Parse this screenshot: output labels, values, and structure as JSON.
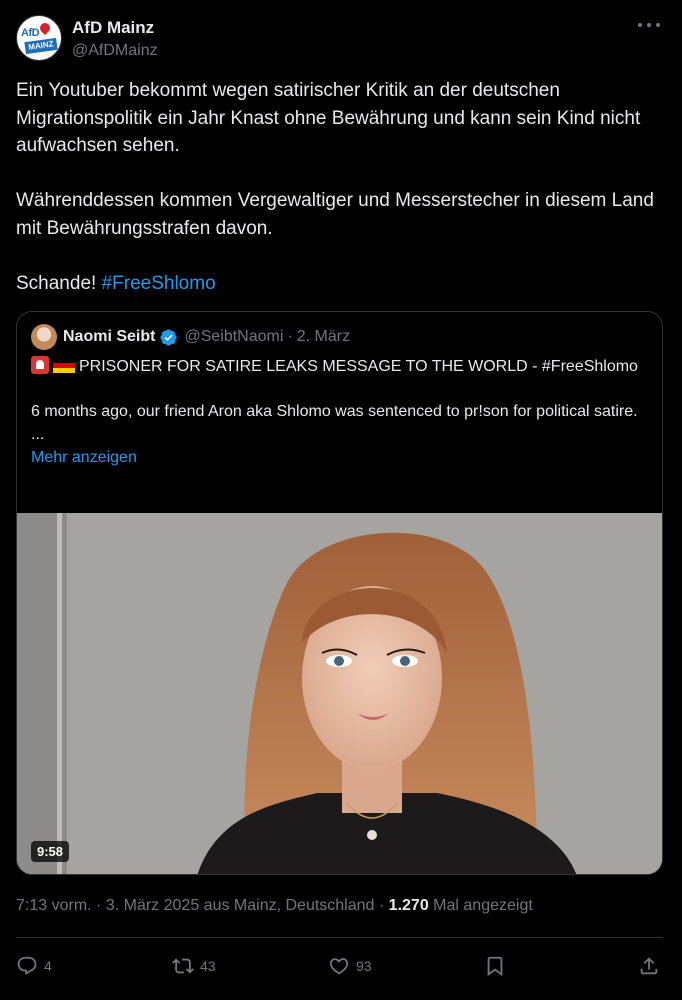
{
  "author": {
    "display_name": "AfD Mainz",
    "handle": "@AfDMainz",
    "avatar_logo_top": "AfD",
    "avatar_logo_band": "MAINZ"
  },
  "tweet": {
    "text_main": "Ein Youtuber bekommt wegen satirischer Kritik an der deutschen Migrationspolitik ein Jahr Knast ohne Bewährung und kann sein Kind nicht aufwachsen sehen.\n\nWährenddessen kommen Vergewaltiger und Messerstecher in diesem Land mit Bewährungsstrafen davon.\n\nSchande! ",
    "hashtag": "#FreeShlomo"
  },
  "quote": {
    "display_name": "Naomi Seibt",
    "handle": "@SeibtNaomi",
    "separator": "·",
    "date": "2. März",
    "text_line1": "PRISONER FOR SATIRE LEAKS MESSAGE TO THE WORLD - #FreeShlomo",
    "text_line2": "\n\n6 months ago, our friend Aron aka Shlomo was sentenced to pr!son for political satire. ...",
    "show_more": "Mehr anzeigen",
    "video_duration": "9:58"
  },
  "meta": {
    "time": "7:13 vorm.",
    "date": "3. März 2025",
    "location": "aus Mainz, Deutschland",
    "views_count": "1.270",
    "views_label": "Mal angezeigt"
  },
  "actions": {
    "replies": "4",
    "reposts": "43",
    "likes": "93"
  },
  "colors": {
    "accent": "#1d9bf0",
    "muted": "#71767b",
    "border": "#2f3336"
  }
}
